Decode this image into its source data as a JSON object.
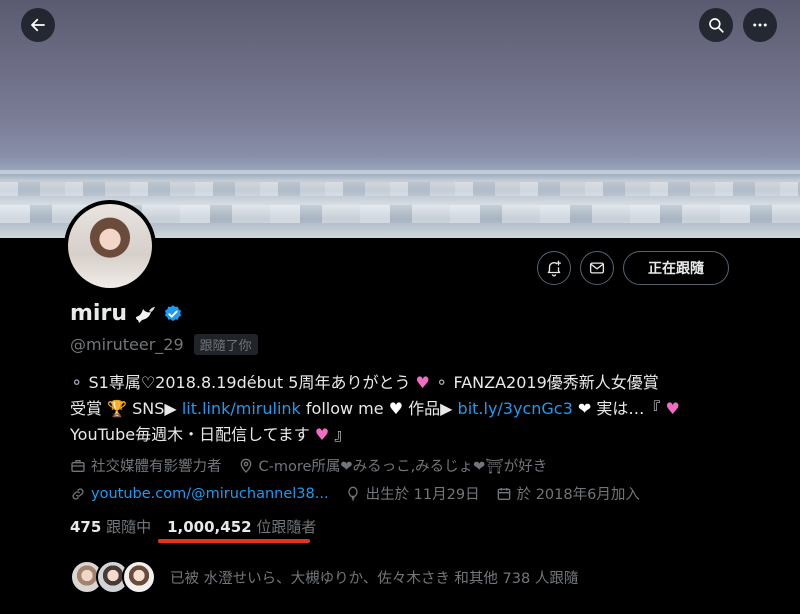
{
  "profile": {
    "name": "miru",
    "handle": "@miruteer_29",
    "follows_you_badge": "跟隨了你",
    "following_button": "正在跟隨"
  },
  "bio": {
    "line1_a": "S1専属♡2018.8.19début 5周年ありがとう",
    "line1_b": "FANZA2019優秀新人女優賞",
    "line2_a": "受賞",
    "line2_b": "SNS▶",
    "link1": "lit.link/mirulink",
    "line2_c": "follow me",
    "line2_d": "作品▶",
    "link2": "bit.ly/3ycnGc3",
    "line2_e": "実は…『",
    "line3_a": "YouTube毎週木・日配信してます",
    "line3_b": "』"
  },
  "meta": {
    "category": "社交媒體有影響力者",
    "location": "C-more所属❤みるっこ,みるじょ❤⛩が好き",
    "website": "youtube.com/@miruchannel38...",
    "birthday": "出生於 11月29日",
    "joined": "於 2018年6月加入"
  },
  "counts": {
    "following_value": "475",
    "following_label": "跟隨中",
    "followers_value": "1,000,452",
    "followers_label": "位跟隨者"
  },
  "followed_by": {
    "text": "已被 水澄せいら、大槻ゆりか、佐々木さき 和其他 738 人跟隨"
  },
  "colors": {
    "accent": "#1d9bf0",
    "highlight_underline": "#e3341f",
    "heart": "#f26bc4"
  }
}
